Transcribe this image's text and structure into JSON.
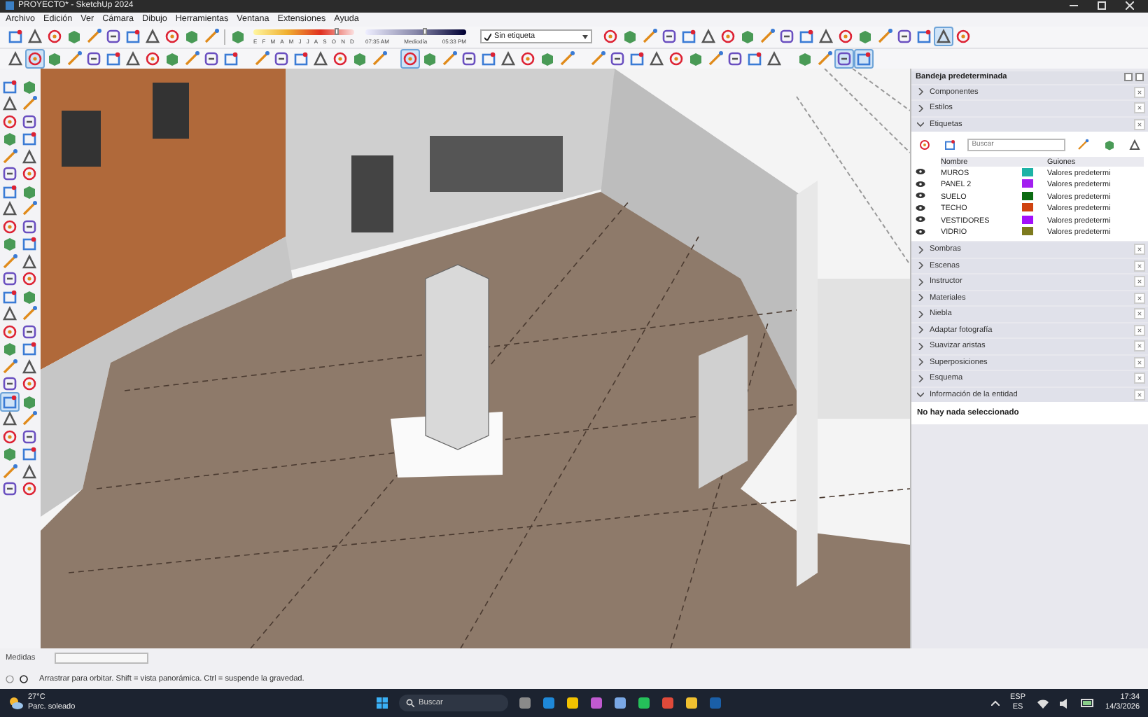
{
  "window": {
    "title": "PROYECTO* - SketchUp 2024"
  },
  "menu": [
    "Archivo",
    "Edición",
    "Ver",
    "Cámara",
    "Dibujo",
    "Herramientas",
    "Ventana",
    "Extensiones",
    "Ayuda"
  ],
  "shadows": {
    "months": [
      "E",
      "F",
      "M",
      "A",
      "M",
      "J",
      "J",
      "A",
      "S",
      "O",
      "N",
      "D"
    ],
    "date_slider": {
      "level": 0.84
    },
    "time_slider": {
      "level": 0.6
    },
    "time_labels": [
      "07:35 AM",
      "Mediodía",
      "05:33 PM"
    ]
  },
  "tag_dropdown": {
    "value": "Sin etiqueta"
  },
  "toolbar_row_1_right": [
    {
      "selected": false
    },
    {
      "selected": false
    },
    {
      "selected": false
    },
    {
      "selected": false
    },
    {
      "selected": false
    },
    {
      "selected": false
    },
    {
      "selected": false
    },
    {
      "selected": false
    },
    {
      "selected": false
    },
    {
      "selected": false
    },
    {
      "selected": false
    },
    {
      "selected": false
    },
    {
      "selected": false
    },
    {
      "selected": false
    },
    {
      "selected": false
    },
    {
      "selected": false
    },
    {
      "selected": false
    },
    {
      "selected": true
    },
    {
      "selected": false
    }
  ],
  "toolbar_row_2_first": [
    {
      "selected": false
    },
    {
      "selected": true
    },
    {
      "selected": false
    },
    {
      "selected": false
    },
    {
      "selected": false
    },
    {
      "selected": false
    },
    {
      "selected": false
    },
    {
      "selected": false
    },
    {
      "selected": false
    },
    {
      "selected": false
    },
    {
      "selected": false
    },
    {
      "selected": false
    }
  ],
  "toolbar_row_2_camera": [
    {
      "selected": true
    },
    {
      "selected": false
    },
    {
      "selected": false
    },
    {
      "selected": false
    },
    {
      "selected": false
    },
    {
      "selected": false
    },
    {
      "selected": false
    },
    {
      "selected": false
    },
    {
      "selected": false
    }
  ],
  "toolbar_row_2_last": [
    {
      "selected": false
    },
    {
      "selected": false
    },
    {
      "selected": true
    },
    {
      "selected": true
    }
  ],
  "left_toolbar": [
    {
      "selected": false
    },
    {
      "selected": false
    },
    {
      "selected": false
    },
    {
      "selected": false
    },
    {
      "selected": false
    },
    {
      "selected": false
    },
    {
      "selected": false
    },
    {
      "selected": false
    },
    {
      "selected": false
    },
    {
      "selected": false
    },
    {
      "selected": false
    },
    {
      "selected": false
    },
    {
      "selected": false
    },
    {
      "selected": false
    },
    {
      "selected": false
    },
    {
      "selected": false
    },
    {
      "selected": false
    },
    {
      "selected": false
    },
    {
      "selected": true
    },
    {
      "selected": false
    },
    {
      "selected": false
    },
    {
      "selected": false
    },
    {
      "selected": false
    },
    {
      "selected": false
    }
  ],
  "tray": {
    "title": "Bandeja predeterminada",
    "panels": [
      {
        "label": "Componentes",
        "expanded": false
      },
      {
        "label": "Estilos",
        "expanded": false
      },
      {
        "label": "Etiquetas",
        "expanded": true,
        "kind": "tags",
        "search": {
          "placeholder": "Buscar"
        },
        "columns": [
          "Nombre",
          "Guiones"
        ],
        "rows": [
          {
            "name": "MUROS",
            "visible": true,
            "color": "#1db3a6",
            "dashes": "Valores predetermi"
          },
          {
            "name": "PANEL 2",
            "visible": true,
            "color": "#a21ff0",
            "dashes": "Valores predetermi"
          },
          {
            "name": "SUELO",
            "visible": true,
            "color": "#0b6b12",
            "dashes": "Valores predetermi"
          },
          {
            "name": "TECHO",
            "visible": true,
            "color": "#cf4310",
            "dashes": "Valores predetermi"
          },
          {
            "name": "VESTIDORES",
            "visible": true,
            "color": "#a30ffc",
            "dashes": "Valores predetermi"
          },
          {
            "name": "VIDRIO",
            "visible": true,
            "color": "#7d7a1e",
            "dashes": "Valores predetermi"
          }
        ]
      },
      {
        "label": "Sombras",
        "expanded": false
      },
      {
        "label": "Escenas",
        "expanded": false
      },
      {
        "label": "Instructor",
        "expanded": false
      },
      {
        "label": "Materiales",
        "expanded": false
      },
      {
        "label": "Niebla",
        "expanded": false
      },
      {
        "label": "Adaptar fotografía",
        "expanded": false
      },
      {
        "label": "Suavizar aristas",
        "expanded": false
      },
      {
        "label": "Superposiciones",
        "expanded": false
      },
      {
        "label": "Esquema",
        "expanded": false
      },
      {
        "label": "Información de la entidad",
        "expanded": true,
        "kind": "entity_info",
        "message": "No hay nada seleccionado"
      }
    ]
  },
  "measurements": {
    "label": "Medidas"
  },
  "status_bar": {
    "text": "Arrastrar para orbitar. Shift = vista panorámica. Ctrl = suspende la gravedad."
  },
  "taskbar": {
    "temperature": "27°C",
    "weather": "Parc. soleado",
    "search": {
      "placeholder": "Buscar"
    },
    "language": "ESP",
    "layout": "ES",
    "time": "17:34",
    "date": "14/3/2026"
  }
}
